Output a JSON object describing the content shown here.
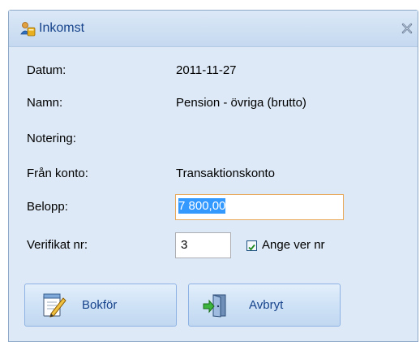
{
  "window": {
    "title": "Inkomst"
  },
  "form": {
    "date_label": "Datum:",
    "date_value": "2011-11-27",
    "name_label": "Namn:",
    "name_value": "Pension - övriga (brutto)",
    "note_label": "Notering:",
    "note_value": "",
    "from_account_label": "Från konto:",
    "from_account_value": "Transaktionskonto",
    "amount_label": "Belopp:",
    "amount_value": "7 800,00",
    "ver_label": "Verifikat nr:",
    "ver_value": "3",
    "ange_ver_checked": true,
    "ange_ver_label": "Ange ver nr"
  },
  "buttons": {
    "bokfor_label": "Bokför",
    "avbryt_label": "Avbryt"
  },
  "icons": {
    "title": "user-money-icon",
    "close": "close-icon",
    "bokfor": "notepad-pencil-icon",
    "avbryt": "door-exit-icon"
  },
  "colors": {
    "title_text": "#15428b",
    "window_bg": "#dde9f6",
    "amount_selection": "#3399ff",
    "focus_border": "#e8a85a"
  }
}
